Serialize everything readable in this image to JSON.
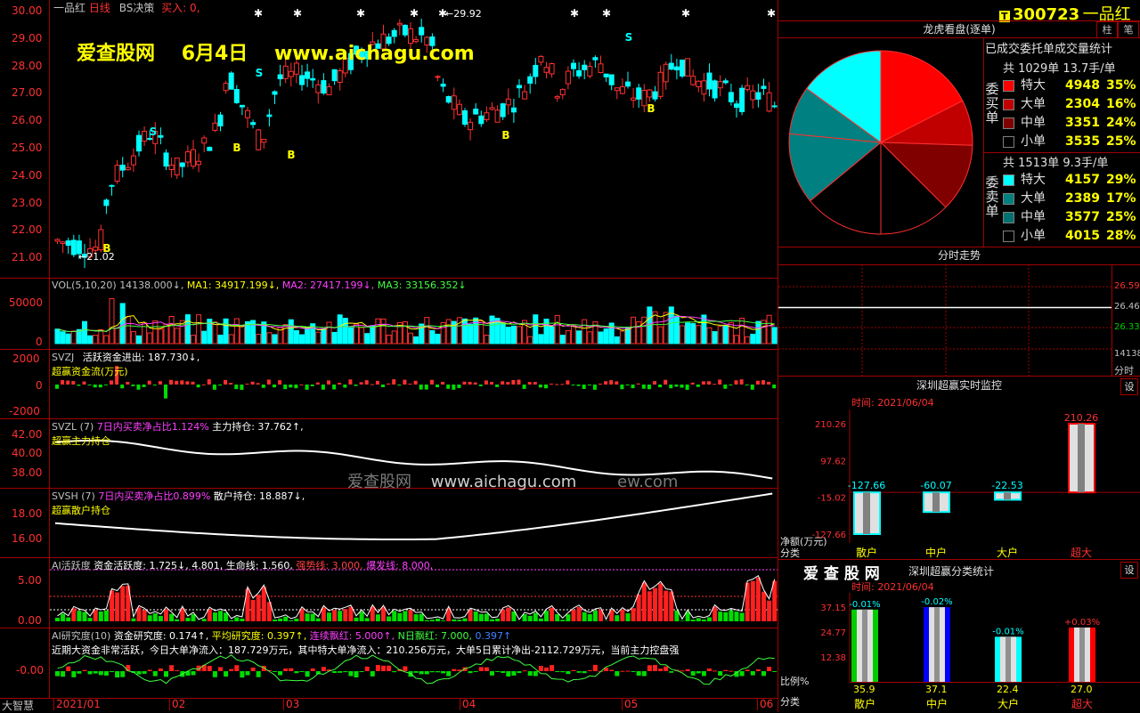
{
  "stock": {
    "code": "300723",
    "name": "一品红",
    "period": "日线",
    "strategy": "BS决策",
    "buy_label": "买入: 0,"
  },
  "watermark": {
    "site": "爱查股网",
    "date": "6月4日",
    "url": "www.aichagu.com",
    "mid": "爱查股网",
    "mid_url": "www.aichagu.com",
    "mid_tail": "ew.com"
  },
  "price_axis": [
    "30.00",
    "29.00",
    "28.00",
    "27.00",
    "26.00",
    "25.00",
    "24.00",
    "23.00",
    "22.00",
    "21.00"
  ],
  "price_annotations": {
    "high": "29.92",
    "low": "21.02"
  },
  "date_axis": [
    "2021/01",
    "02",
    "03",
    "04",
    "05",
    "06"
  ],
  "vol": {
    "header": "VOL(5,10,20)",
    "v": "14138.000↓,",
    "ma1_label": "MA1: 34917.199↓,",
    "ma2_label": "MA2: 27417.199↓,",
    "ma3_label": "MA3: 33156.352↓",
    "ticks": [
      "50000",
      "0"
    ]
  },
  "svzj": {
    "header": "SVZJ",
    "title": "活跃资金进出: 187.730↓,",
    "subtitle": "超赢资金流(万元)",
    "ticks": [
      "2000",
      "0",
      "-2000"
    ]
  },
  "svzl": {
    "header": "SVZL (7)",
    "ratio": "7日内买卖净占比1.124%",
    "hold": "主力持仓: 37.762↑,",
    "subtitle": "超赢主力持仓",
    "ticks": [
      "42.00",
      "40.00",
      "38.00"
    ]
  },
  "svsh": {
    "header": "SVSH (7)",
    "ratio": "7日内买卖净占比0.899%",
    "hold": "散户持仓: 18.887↓,",
    "subtitle": "超赢散户持仓",
    "ticks": [
      "18.00",
      "16.00"
    ]
  },
  "ai": {
    "header": "AI活跃度",
    "active": "资金活跃度: 1.725↓,",
    "v2": "4.801,",
    "life": "生命线: 1.560,",
    "strong": "强势线: 3.000,",
    "burst": "爆发线: 8.000,",
    "ticks": [
      "5.00",
      "0.00"
    ]
  },
  "research": {
    "header": "AI研究度(10)",
    "r1": "资金研究度: 0.174↑,",
    "r2": "平均研究度: 0.397↑,",
    "r3": "连续飘红: 5.000↑,",
    "r4": "N日飘红: 7.000,",
    "r5": "0.397↑",
    "summary": "近期大资金非常活跃，今日大单净流入：187.729万元，其中特大单净流入：210.256万元，大单5日累计净出-2112.729万元，当前主力控盘强",
    "ticks": [
      "-0.00"
    ]
  },
  "logo_label": "大智慧",
  "right": {
    "tab_zhu": "柱",
    "tab_bi": "笔",
    "lhb_title": "龙虎看盘(逐单)",
    "lhb_subtitle": "已成交委托单成交量统计",
    "buy_group": "委买单",
    "buy_total": "共 1029单 13.7手/单",
    "buy_rows": [
      {
        "label": "特大",
        "num": "4948",
        "pct": "35%",
        "color": "#ff0000"
      },
      {
        "label": "大单",
        "num": "2304",
        "pct": "16%",
        "color": "#c00000"
      },
      {
        "label": "中单",
        "num": "3351",
        "pct": "24%",
        "color": "#800000"
      },
      {
        "label": "小单",
        "num": "3535",
        "pct": "25%",
        "color": "#000000"
      }
    ],
    "sell_group": "委卖单",
    "sell_total": "共 1513单 9.3手/单",
    "sell_rows": [
      {
        "label": "特大",
        "num": "4157",
        "pct": "29%",
        "color": "#00ffff"
      },
      {
        "label": "大单",
        "num": "2389",
        "pct": "17%",
        "color": "#008080"
      },
      {
        "label": "中单",
        "num": "3577",
        "pct": "25%",
        "color": "#007070"
      },
      {
        "label": "小单",
        "num": "4015",
        "pct": "28%",
        "color": "#000000"
      }
    ],
    "fenshi_title": "分时走势",
    "fenshi_ticks": [
      "26.59",
      "26.46",
      "26.33"
    ],
    "fenshi_vol": "14138",
    "fenshi_label": "分时",
    "monitor_title": "深圳超赢实时监控",
    "set_label": "设",
    "monitor_time": "时间: 2021/06/04",
    "monitor_ticks": [
      "210.26",
      "97.62",
      "-15.02",
      "-127.66"
    ],
    "monitor_unit": "净额(万元)",
    "monitor_cat": "分类",
    "monitor_bars": [
      {
        "cat": "散户",
        "val": "-127.66"
      },
      {
        "cat": "中户",
        "val": "-60.07"
      },
      {
        "cat": "大户",
        "val": "-22.53"
      },
      {
        "cat": "超大",
        "val": "210.26"
      }
    ],
    "class_brand": "爱 查 股 网",
    "class_title": "深圳超赢分类统计",
    "class_time": "时间: 2021/06/04",
    "class_ticks": [
      "37.15",
      "24.77",
      "12.38"
    ],
    "class_ratio": "比例%",
    "class_cat": "分类",
    "class_bars": [
      {
        "cat": "散户",
        "top": "-0.01%",
        "bottom": "35.9",
        "color": "#00cc00"
      },
      {
        "cat": "中户",
        "top": "-0.02%",
        "bottom": "37.1",
        "color": "#0000ff"
      },
      {
        "cat": "大户",
        "top": "-0.01%",
        "bottom": "22.4",
        "color": "#00ffff"
      },
      {
        "cat": "超大",
        "top": "+0.03%",
        "bottom": "27.0",
        "color": "#ff0000"
      }
    ]
  }
}
